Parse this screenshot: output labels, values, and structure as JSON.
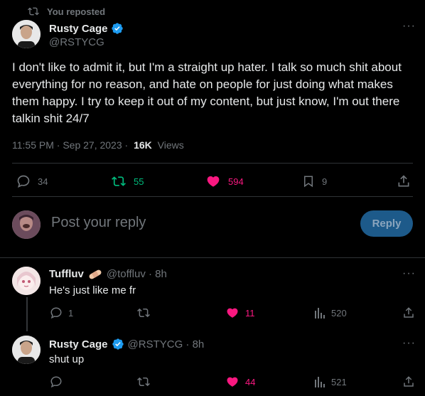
{
  "repost": {
    "label": "You reposted"
  },
  "main_tweet": {
    "author_name": "Rusty Cage",
    "author_handle": "@RSTYCG",
    "text": "I don't like to admit it, but I'm a straight up hater. I talk so much shit about everything for no reason, and hate on people for just doing what makes them happy. I try to keep it out of my content, but just know, I'm out there talkin shit 24/7",
    "time": "11:55 PM · Sep 27, 2023 · ",
    "views_count": "16K",
    "views_label": " Views",
    "stats": {
      "replies": "34",
      "reposts": "55",
      "likes": "594",
      "bookmarks": "9"
    }
  },
  "composer": {
    "placeholder": "Post your reply",
    "button_label": "Reply"
  },
  "replies": [
    {
      "author_name": "Tuffluv",
      "handle_time": "@toffluv · 8h",
      "text": "He's just like me fr",
      "stats": {
        "replies": "1",
        "reposts": "",
        "likes": "11",
        "views": "520"
      }
    },
    {
      "author_name": "Rusty Cage",
      "handle_time": "@RSTYCG · 8h",
      "text": "shut up",
      "stats": {
        "replies": "",
        "reposts": "",
        "likes": "44",
        "views": "521"
      }
    }
  ],
  "colors": {
    "accent": "#1d9bf0",
    "like": "#f91880",
    "repost": "#00ba7c",
    "background": "#000000"
  }
}
